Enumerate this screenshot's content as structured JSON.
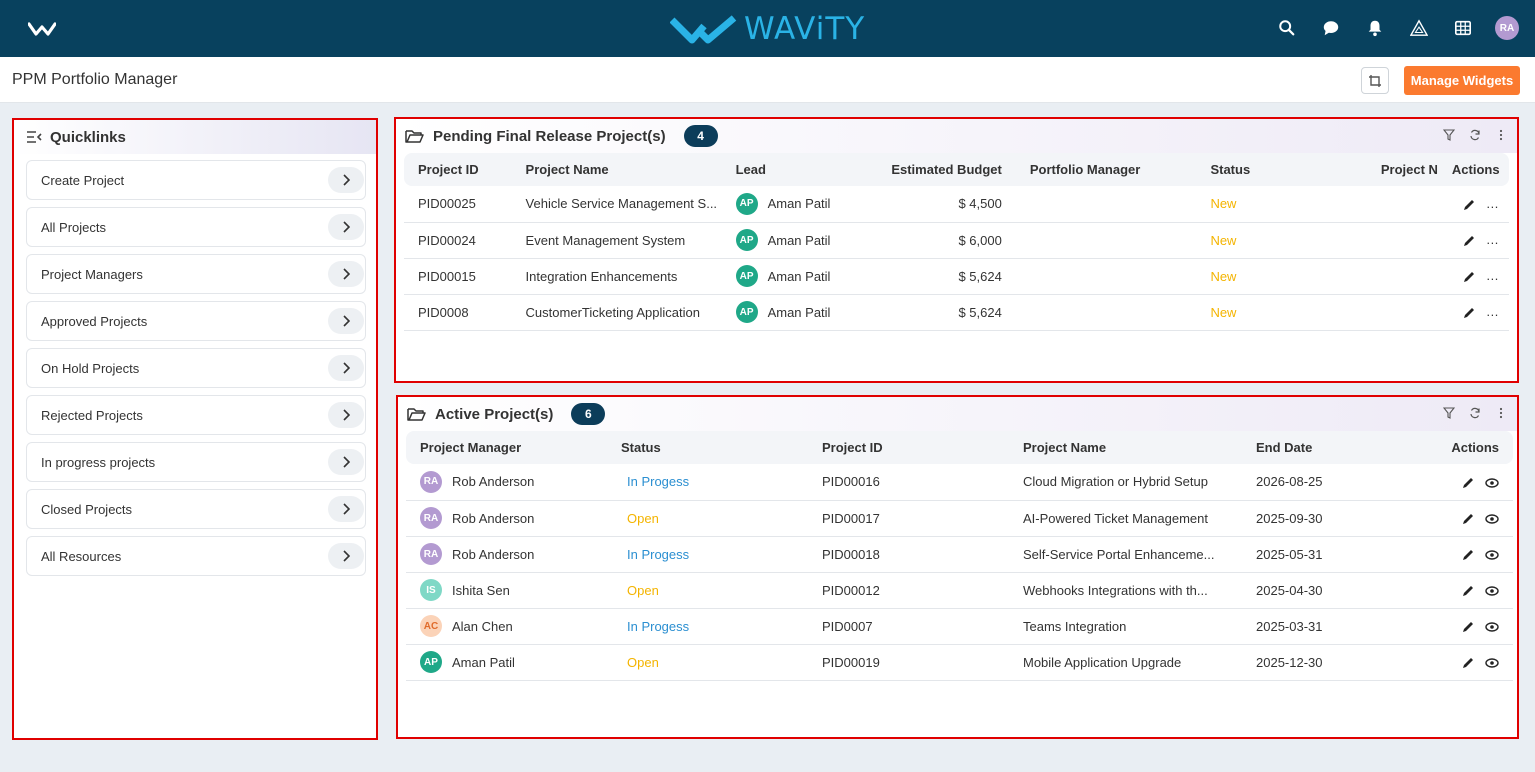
{
  "brand": {
    "name": "WAViTY",
    "avatar_initials": "RA"
  },
  "nav_icons": [
    "search-icon",
    "chat-icon",
    "bell-icon",
    "triangle-icon",
    "grid-icon"
  ],
  "header": {
    "title": "PPM Portfolio Manager",
    "manage_widgets_label": "Manage Widgets"
  },
  "quicklinks": {
    "title": "Quicklinks",
    "items": [
      "Create Project",
      "All Projects",
      "Project Managers",
      "Approved Projects",
      "On Hold Projects",
      "Rejected Projects",
      "In progress projects",
      "Closed Projects",
      "All Resources"
    ]
  },
  "pending": {
    "title": "Pending Final Release Project(s)",
    "count": "4",
    "columns": [
      "Project ID",
      "Project Name",
      "Lead",
      "Estimated Budget",
      "Portfolio Manager",
      "Status",
      "Project N",
      "Actions"
    ],
    "rows": [
      {
        "id": "PID00025",
        "name": "Vehicle Service Management S...",
        "lead_initials": "AP",
        "lead": "Aman Patil",
        "budget": "$ 4,500",
        "portfolio_manager": "",
        "status": "New",
        "pm": ""
      },
      {
        "id": "PID00024",
        "name": "Event Management System",
        "lead_initials": "AP",
        "lead": "Aman Patil",
        "budget": "$ 6,000",
        "portfolio_manager": "",
        "status": "New",
        "pm": ""
      },
      {
        "id": "PID00015",
        "name": "Integration Enhancements",
        "lead_initials": "AP",
        "lead": "Aman Patil",
        "budget": "$ 5,624",
        "portfolio_manager": "",
        "status": "New",
        "pm": ""
      },
      {
        "id": "PID0008",
        "name": "CustomerTicketing Application",
        "lead_initials": "AP",
        "lead": "Aman Patil",
        "budget": "$ 5,624",
        "portfolio_manager": "",
        "status": "New",
        "pm": ""
      }
    ]
  },
  "active": {
    "title": "Active Project(s)",
    "count": "6",
    "columns": [
      "Project Manager",
      "Status",
      "Project ID",
      "Project Name",
      "End Date",
      "Actions"
    ],
    "rows": [
      {
        "initials": "RA",
        "manager": "Rob Anderson",
        "status": "In Progess",
        "id": "PID00016",
        "name": "Cloud Migration or Hybrid Setup",
        "end": "2026-08-25"
      },
      {
        "initials": "RA",
        "manager": "Rob Anderson",
        "status": "Open",
        "id": "PID00017",
        "name": "AI-Powered Ticket Management",
        "end": "2025-09-30"
      },
      {
        "initials": "RA",
        "manager": "Rob Anderson",
        "status": "In Progess",
        "id": "PID00018",
        "name": "Self-Service Portal Enhanceme...",
        "end": "2025-05-31"
      },
      {
        "initials": "IS",
        "manager": "Ishita Sen",
        "status": "Open",
        "id": "PID00012",
        "name": "Webhooks Integrations with th...",
        "end": "2025-04-30"
      },
      {
        "initials": "AC",
        "manager": "Alan Chen",
        "status": "In Progess",
        "id": "PID0007",
        "name": "Teams Integration",
        "end": "2025-03-31"
      },
      {
        "initials": "AP",
        "manager": "Aman Patil",
        "status": "Open",
        "id": "PID00019",
        "name": "Mobile Application Upgrade",
        "end": "2025-12-30"
      }
    ]
  },
  "colors": {
    "nav": "#08415e",
    "accent": "#fb7a2f",
    "badge": "#0c3d5a",
    "status_new": "#f4b400",
    "status_progress": "#2b8fd1"
  }
}
